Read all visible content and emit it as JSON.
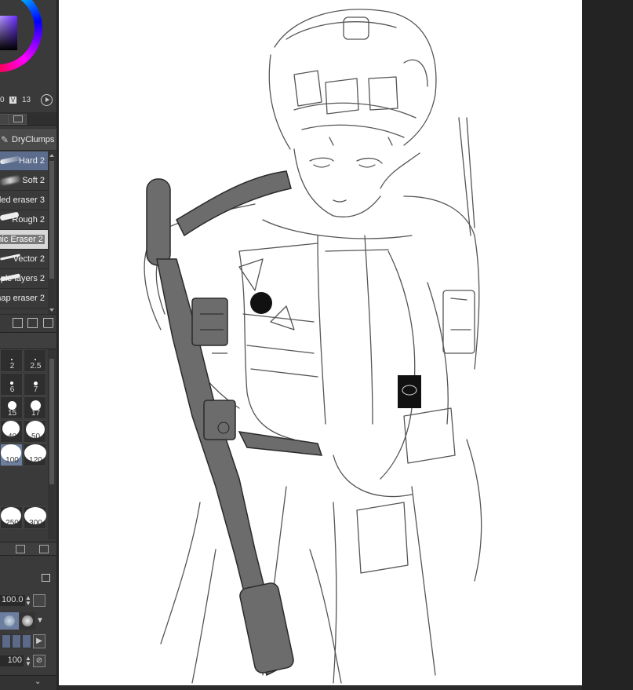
{
  "color_panel": {
    "hsv_values": [
      "0",
      "V",
      "13"
    ],
    "icons": [
      "color-wheel-icon",
      "play-icon"
    ]
  },
  "tool_panel": {
    "sub_tool_name": "DryClumps",
    "brushes": [
      {
        "name": "Hard 2",
        "selected": true
      },
      {
        "name": "Soft 2",
        "selected": false
      },
      {
        "name": "ded eraser 3",
        "selected": false
      },
      {
        "name": "Rough 2",
        "selected": false
      },
      {
        "name": "mic Eraser 2",
        "selected": false
      },
      {
        "name": "Vector 2",
        "selected": false
      },
      {
        "name": "iple layers 2",
        "selected": false
      },
      {
        "name": "nap eraser 2",
        "selected": false
      }
    ],
    "buttons": [
      "import-brush-icon",
      "duplicate-brush-icon",
      "delete-brush-icon"
    ]
  },
  "brush_size_panel": {
    "sizes": [
      {
        "label": "2"
      },
      {
        "label": "2.5"
      },
      {
        "label": "6"
      },
      {
        "label": "7"
      },
      {
        "label": "15"
      },
      {
        "label": "17"
      },
      {
        "label": "40"
      },
      {
        "label": "50"
      },
      {
        "label": "100",
        "selected": true
      },
      {
        "label": "120"
      },
      {
        "label": "250"
      },
      {
        "label": "300"
      }
    ]
  },
  "tool_property": {
    "opacity_value": "100.0",
    "density_value": "100"
  },
  "colors": {
    "panel_bg": "#3a3a3a",
    "selection": "#5b6c8c",
    "canvas_bg": "#ffffff",
    "workspace_bg": "#2b2b2b"
  }
}
